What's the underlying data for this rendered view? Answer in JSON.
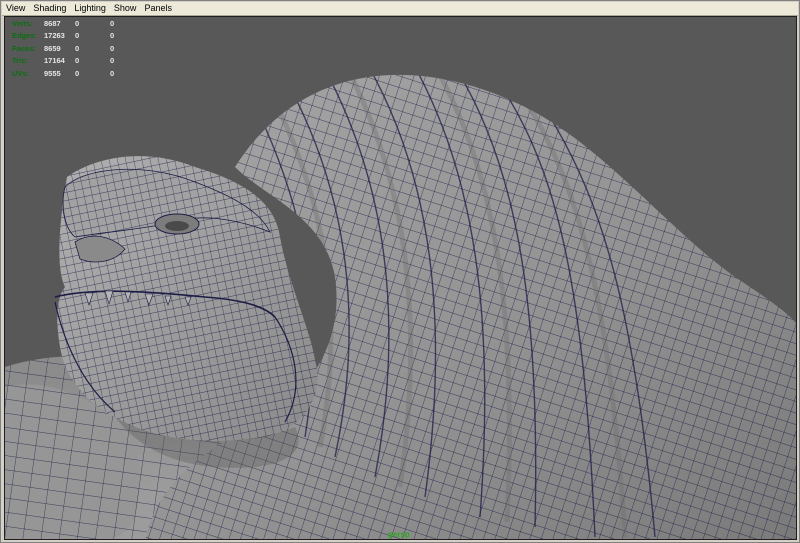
{
  "menu": {
    "items": [
      "View",
      "Shading",
      "Lighting",
      "Show",
      "Panels"
    ]
  },
  "hud": {
    "rows": [
      {
        "label": "Verts:",
        "v1": "8687",
        "v2": "0",
        "v3": "0"
      },
      {
        "label": "Edges:",
        "v1": "17263",
        "v2": "0",
        "v3": "0"
      },
      {
        "label": "Faces:",
        "v1": "8659",
        "v2": "0",
        "v3": "0"
      },
      {
        "label": "Tris:",
        "v1": "17164",
        "v2": "0",
        "v3": "0"
      },
      {
        "label": "UVs:",
        "v1": "9555",
        "v2": "0",
        "v3": "0"
      }
    ]
  },
  "viewport": {
    "camera_label": "persp"
  },
  "colors": {
    "viewport_bg": "#585858",
    "mesh_fill": "#9b9b9b",
    "wire": "#1c1c46",
    "hud_label": "#0c6e12",
    "hud_value": "#e6e6e6",
    "camera_label": "#29a81c"
  }
}
